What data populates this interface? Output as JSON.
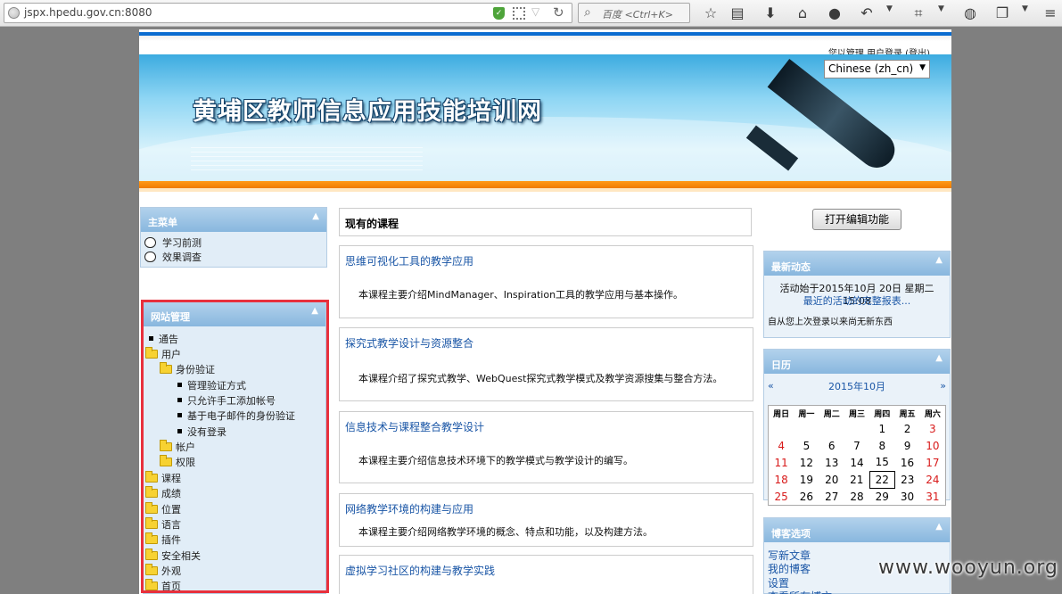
{
  "browser": {
    "url": "jspx.hpedu.gov.cn:8080",
    "search_placeholder": "百度 <Ctrl+K>"
  },
  "header": {
    "login_text": "您以管理 用户登录 (登出)",
    "language": "Chinese (zh_cn)",
    "site_title": "黄埔区教师信息应用技能培训网"
  },
  "main_menu": {
    "title": "主菜单",
    "items": [
      "学习前测",
      "效果调查"
    ]
  },
  "site_admin": {
    "title": "网站管理",
    "notice": "通告",
    "users": "用户",
    "auth": "身份验证",
    "auth_items": [
      "管理验证方式",
      "只允许手工添加帐号",
      "基于电子邮件的身份验证",
      "没有登录"
    ],
    "accounts": "帐户",
    "permissions": "权限",
    "others": [
      "课程",
      "成绩",
      "位置",
      "语言",
      "插件",
      "安全相关",
      "外观",
      "首页"
    ]
  },
  "courses": {
    "title": "现有的课程",
    "list": [
      {
        "name": "思维可视化工具的教学应用",
        "desc": "本课程主要介绍MindManager、Inspiration工具的教学应用与基本操作。"
      },
      {
        "name": "探究式教学设计与资源整合",
        "desc": "本课程介绍了探究式教学、WebQuest探究式教学模式及教学资源搜集与整合方法。"
      },
      {
        "name": "信息技术与课程整合教学设计",
        "desc": "本课程主要介绍信息技术环境下的教学模式与教学设计的编写。"
      },
      {
        "name": "网络教学环境的构建与应用",
        "desc": "本课程主要介绍网络教学环境的概念、特点和功能，以及构建方法。"
      },
      {
        "name": "虚拟学习社区的构建与教学实践",
        "desc": ""
      }
    ]
  },
  "right": {
    "edit_button": "打开编辑功能",
    "activity": {
      "title": "最新动态",
      "since": "活动始于2015年10月 20日 星期二 15:08",
      "full_report": "最近的活动的完整报表...",
      "nothing": "自从您上次登录以来尚无新东西"
    },
    "calendar": {
      "title": "日历",
      "prev": "«",
      "next": "»",
      "month": "2015年10月",
      "weekdays": [
        "周日",
        "周一",
        "周二",
        "周三",
        "周四",
        "周五",
        "周六"
      ],
      "weeks": [
        [
          "",
          "",
          "",
          "",
          "1",
          "2",
          "3"
        ],
        [
          "4",
          "5",
          "6",
          "7",
          "8",
          "9",
          "10"
        ],
        [
          "11",
          "12",
          "13",
          "14",
          "15",
          "16",
          "17"
        ],
        [
          "18",
          "19",
          "20",
          "21",
          "22",
          "23",
          "24"
        ],
        [
          "25",
          "26",
          "27",
          "28",
          "29",
          "30",
          "31"
        ]
      ],
      "today": "22"
    },
    "blog": {
      "title": "博客选项",
      "items": [
        "写新文章",
        "我的博客",
        "设置",
        "查看所有博文"
      ]
    }
  },
  "watermark": "www.wooyun.org",
  "colors": {
    "accent_blue": "#0a6cd0",
    "orange_band": "#f07b00",
    "highlight_red": "#e8303c",
    "link": "#1a56a6"
  }
}
